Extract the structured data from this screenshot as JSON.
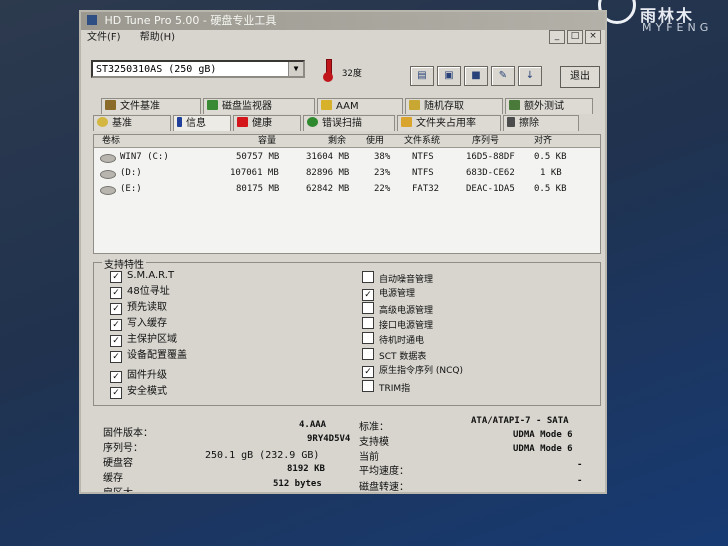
{
  "brand": {
    "name_cn": "雨林木",
    "name_en": "MYFENG"
  },
  "window": {
    "title": "HD Tune Pro 5.00 - 硬盘专业工具"
  },
  "menu": {
    "file": "文件(F)",
    "help": "帮助(H)"
  },
  "window_buttons": {
    "minimize": "_",
    "maximize": "□",
    "close": "×"
  },
  "toolbar": {
    "drive": "ST3250310AS (250 gB)",
    "temperature": "32度",
    "exit": "退出",
    "icons": [
      "copy-text-icon",
      "copy-screen-icon",
      "save-icon",
      "options-icon",
      "download-icon"
    ]
  },
  "tabs_row1": [
    {
      "label": "文件基准",
      "icon": "file-benchmark-icon"
    },
    {
      "label": "磁盘监视器",
      "icon": "disk-monitor-icon"
    },
    {
      "label": "AAM",
      "icon": "speaker-icon"
    },
    {
      "label": "随机存取",
      "icon": "random-access-icon"
    },
    {
      "label": "额外测试",
      "icon": "extra-tests-icon"
    }
  ],
  "tabs_row2": [
    {
      "label": "基准",
      "icon": "benchmark-icon"
    },
    {
      "label": "信息",
      "icon": "info-icon",
      "active": true
    },
    {
      "label": "健康",
      "icon": "health-icon"
    },
    {
      "label": "错误扫描",
      "icon": "error-scan-icon"
    },
    {
      "label": "文件夹占用率",
      "icon": "folder-usage-icon"
    },
    {
      "label": "擦除",
      "icon": "erase-icon"
    }
  ],
  "partition_table": {
    "columns": [
      "卷标",
      "容量",
      "剩余",
      "使用",
      "文件系统",
      "序列号",
      "对齐"
    ],
    "rows": [
      {
        "label": "WIN7 (C:)",
        "capacity": "50757 MB",
        "free": "31604 MB",
        "used": "38%",
        "fs": "NTFS",
        "serial": "16D5-88DF",
        "align": "0.5 KB"
      },
      {
        "label": "(D:)",
        "capacity": "107061 MB",
        "free": "82896 MB",
        "used": "23%",
        "fs": "NTFS",
        "serial": "683D-CE62",
        "align": "1 KB"
      },
      {
        "label": "(E:)",
        "capacity": "80175 MB",
        "free": "62842 MB",
        "used": "22%",
        "fs": "FAT32",
        "serial": "DEAC-1DA5",
        "align": "0.5 KB"
      }
    ]
  },
  "features": {
    "legend": "支持特性",
    "left": [
      {
        "label": "S.M.A.R.T",
        "checked": true
      },
      {
        "label": "48位寻址",
        "checked": true
      },
      {
        "label": "预先读取",
        "checked": true
      },
      {
        "label": "写入缓存",
        "checked": true
      },
      {
        "label": "主保护区域",
        "checked": true
      },
      {
        "label": "设备配置覆盖",
        "checked": true
      },
      {
        "label": "固件升级",
        "checked": true
      },
      {
        "label": "安全模式",
        "checked": true
      }
    ],
    "right": [
      {
        "label": "自动噪音管理",
        "checked": false
      },
      {
        "label": "电源管理",
        "checked": true
      },
      {
        "label": "高级电源管理",
        "checked": false
      },
      {
        "label": "接口电源管理",
        "checked": false
      },
      {
        "label": "待机时通电",
        "checked": false
      },
      {
        "label": "SCT 数据表",
        "checked": false
      },
      {
        "label": "原生指令序列 (NCQ)",
        "checked": true
      },
      {
        "label": "TRIM指",
        "checked": false
      }
    ]
  },
  "info_left": [
    {
      "label": "固件版本：",
      "value": "4.AAA"
    },
    {
      "label": "序列号：",
      "value": "9RY4D5V4"
    },
    {
      "label": "硬盘容",
      "value": "250.1 gB (232.9 GB)"
    },
    {
      "label": "缓存",
      "value": "8192 KB"
    },
    {
      "label": "扇区大",
      "value": "512 bytes"
    }
  ],
  "info_right": [
    {
      "label": "标准：",
      "value": "ATA/ATAPI-7 - SATA"
    },
    {
      "label": "支持模",
      "value": "UDMA Mode 6"
    },
    {
      "label": "当前",
      "value": "UDMA Mode 6"
    },
    {
      "label": "平均速度：",
      "value": "-"
    },
    {
      "label": "磁盘转速：",
      "value": "-"
    }
  ]
}
